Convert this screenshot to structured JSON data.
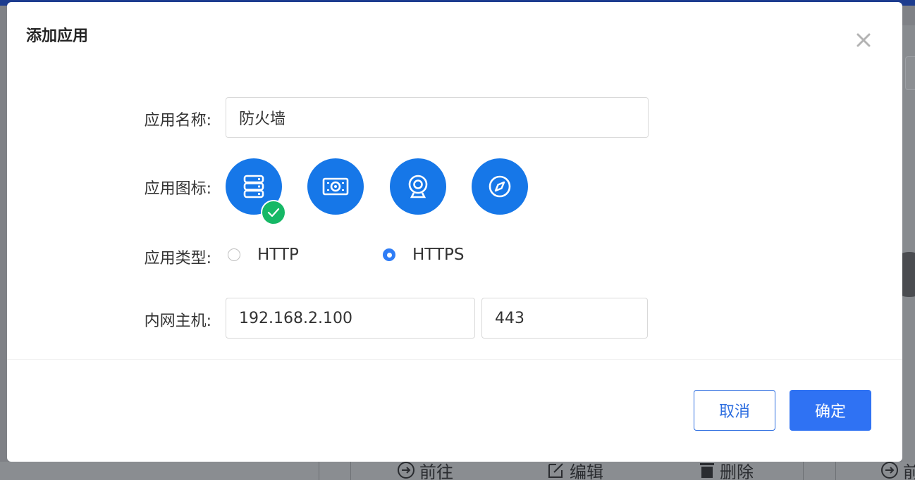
{
  "dialog": {
    "title": "添加应用",
    "close_label": "×"
  },
  "form": {
    "name": {
      "label": "应用名称:",
      "value": "防火墙"
    },
    "icon": {
      "label": "应用图标:",
      "options": [
        "server-icon",
        "camera-monitor-icon",
        "webcam-icon",
        "compass-icon"
      ],
      "selected": "server-icon"
    },
    "type": {
      "label": "应用类型:",
      "options": [
        "HTTP",
        "HTTPS"
      ],
      "selected": "HTTPS"
    },
    "host": {
      "label": "内网主机:",
      "ip": "192.168.2.100",
      "port": "443"
    }
  },
  "footer": {
    "cancel_label": "取消",
    "ok_label": "确定"
  },
  "background": {
    "actions": [
      "前往",
      "编辑",
      "删除",
      "前"
    ]
  },
  "colors": {
    "primary": "#2f72f3",
    "icon_bg": "#1677e8",
    "check": "#16b866",
    "overlay": "#7f8186"
  }
}
